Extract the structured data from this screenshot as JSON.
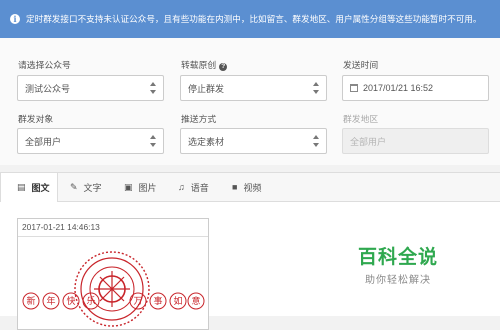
{
  "notice": {
    "icon": "info-icon",
    "text": "定时群发接口不支持未认证公众号，且有些功能在内测中，比如留言、群发地区、用户属性分组等这些功能暂时不可用。"
  },
  "form": {
    "account": {
      "label": "请选择公众号",
      "value": "测试公众号"
    },
    "repost": {
      "label": "转载原创",
      "value": "停止群发",
      "help_icon": "question-icon"
    },
    "send_time": {
      "label": "发送时间",
      "value": "2017/01/21 16:52",
      "icon": "calendar-icon"
    },
    "target": {
      "label": "群发对象",
      "value": "全部用户"
    },
    "push_mode": {
      "label": "推送方式",
      "value": "选定素材"
    },
    "region": {
      "label": "群发地区",
      "value": "全部用户",
      "disabled": true
    }
  },
  "tabs": [
    {
      "label": "图文",
      "icon": "news-icon",
      "active": true
    },
    {
      "label": "文字",
      "icon": "edit-icon"
    },
    {
      "label": "图片",
      "icon": "image-icon"
    },
    {
      "label": "语音",
      "icon": "music-icon"
    },
    {
      "label": "视频",
      "icon": "video-icon"
    }
  ],
  "card": {
    "timestamp": "2017-01-21 14:46:13",
    "greeting": [
      "新",
      "年",
      "快",
      "乐",
      "万",
      "事",
      "如",
      "意"
    ]
  },
  "watermark": {
    "title": "百科全说",
    "subtitle": "助你轻松解决"
  },
  "colors": {
    "notice_bg": "#5b8fd1",
    "seal_red": "#c8242a",
    "brand_green": "#2fa84f"
  }
}
